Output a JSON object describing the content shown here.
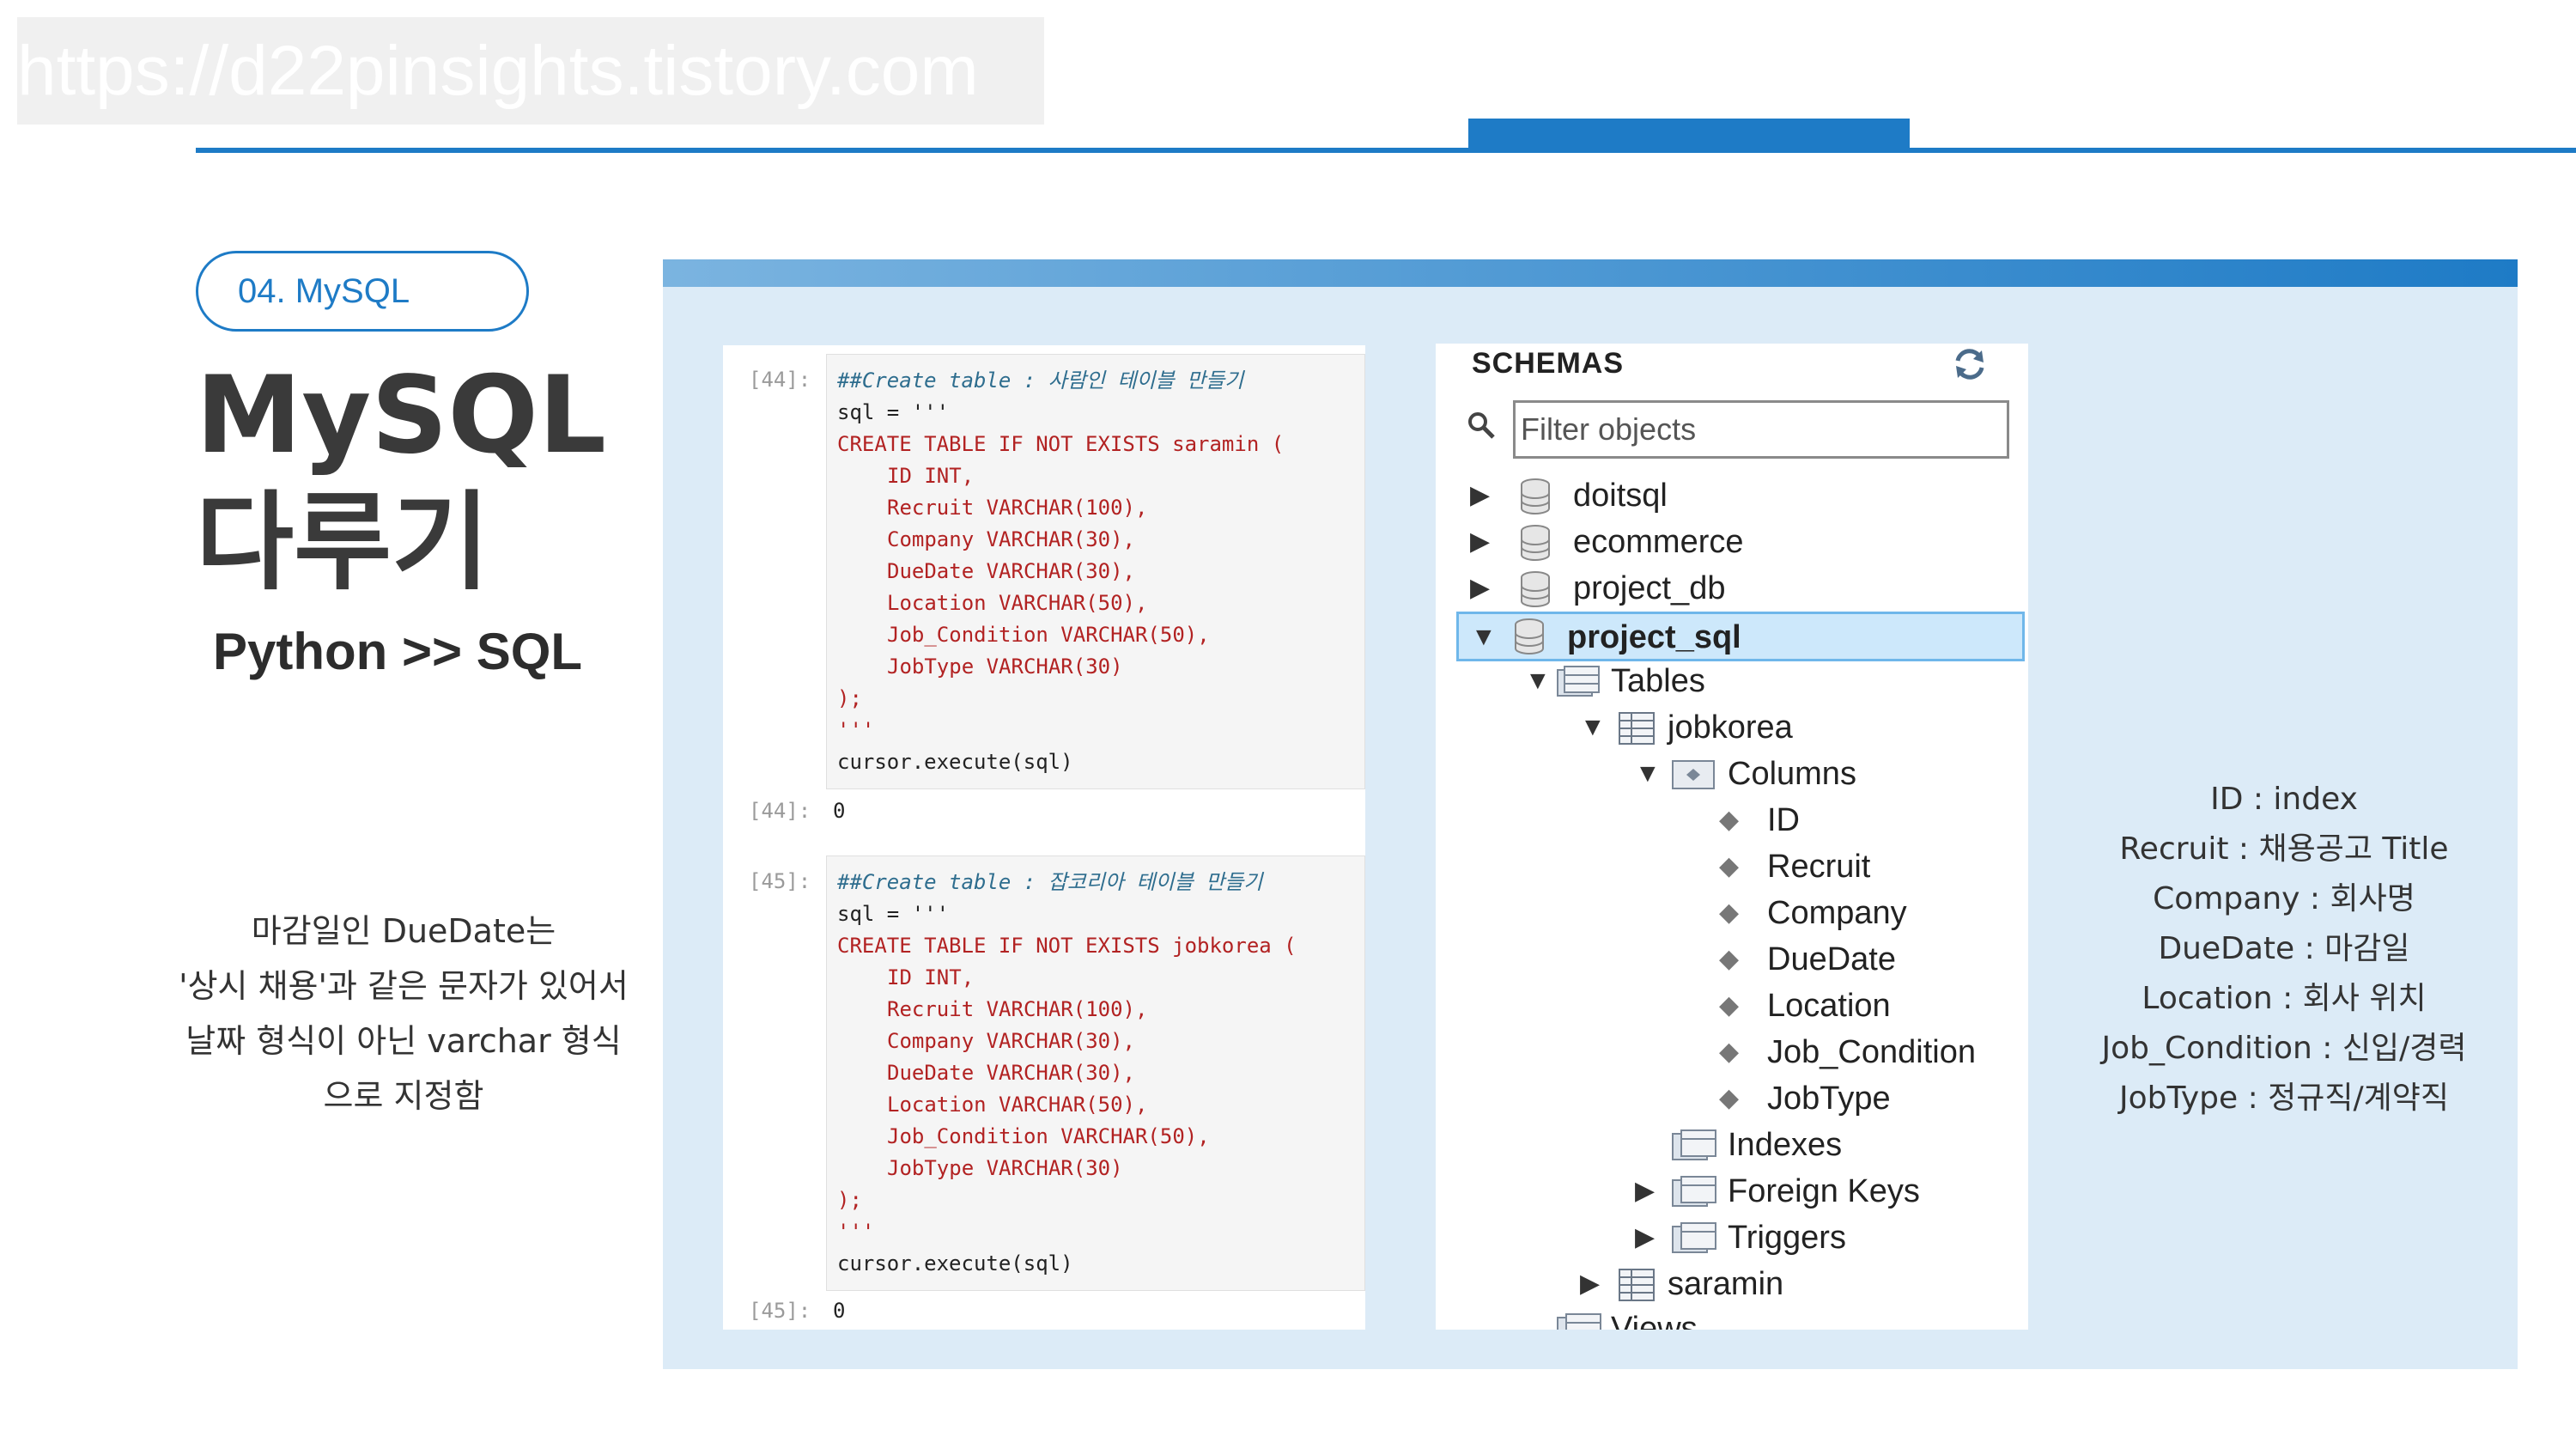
{
  "watermark": "https://d22pinsights.tistory.com",
  "section_pill": "04. MySQL",
  "title_line1": "MySQL",
  "title_line2": "다루기",
  "subtitle": "Python >> SQL",
  "note_lines": [
    "마감일인 DueDate는",
    "'상시 채용'과 같은 문자가 있어서",
    "날짜 형식이 아닌 varchar 형식",
    "으로 지정함"
  ],
  "notebook": {
    "cell1": {
      "prompt": "[44]:",
      "lines": [
        "##Create table : 사람인 테이블 만들기",
        "sql = '''",
        "CREATE TABLE IF NOT EXISTS saramin (",
        "ID INT,",
        "Recruit VARCHAR(100),",
        "Company VARCHAR(30),",
        "DueDate VARCHAR(30),",
        "Location VARCHAR(50),",
        "Job_Condition VARCHAR(50),",
        "JobType VARCHAR(30)",
        ");",
        "'''",
        "cursor.execute(sql)"
      ],
      "out_prompt": "[44]:",
      "out_value": "0"
    },
    "cell2": {
      "prompt": "[45]:",
      "lines": [
        "##Create table : 잡코리아 테이블 만들기",
        "sql = '''",
        "CREATE TABLE IF NOT EXISTS jobkorea (",
        "ID INT,",
        "Recruit VARCHAR(100),",
        "Company VARCHAR(30),",
        "DueDate VARCHAR(30),",
        "Location VARCHAR(50),",
        "Job_Condition VARCHAR(50),",
        "JobType VARCHAR(30)",
        ");",
        "'''",
        "cursor.execute(sql)"
      ],
      "out_prompt": "[45]:",
      "out_value": "0"
    }
  },
  "schemas": {
    "title": "SCHEMAS",
    "filter_placeholder": "Filter objects",
    "databases": [
      "doitsql",
      "ecommerce",
      "project_db",
      "project_sql"
    ],
    "tables_label": "Tables",
    "table_jobkorea": "jobkorea",
    "columns_label": "Columns",
    "columns": [
      "ID",
      "Recruit",
      "Company",
      "DueDate",
      "Location",
      "Job_Condition",
      "JobType"
    ],
    "indexes_label": "Indexes",
    "foreign_keys_label": "Foreign Keys",
    "triggers_label": "Triggers",
    "table_saramin": "saramin",
    "views_label": "Views"
  },
  "legend": [
    "ID : index",
    "Recruit : 채용공고 Title",
    "Company : 회사명",
    "DueDate : 마감일",
    "Location : 회사 위치",
    "Job_Condition : 신입/경력",
    "JobType : 정규직/계약직"
  ],
  "colors": {
    "accent": "#1e7bc6",
    "panel": "#dcebf7",
    "selected": "#cde8fb"
  }
}
